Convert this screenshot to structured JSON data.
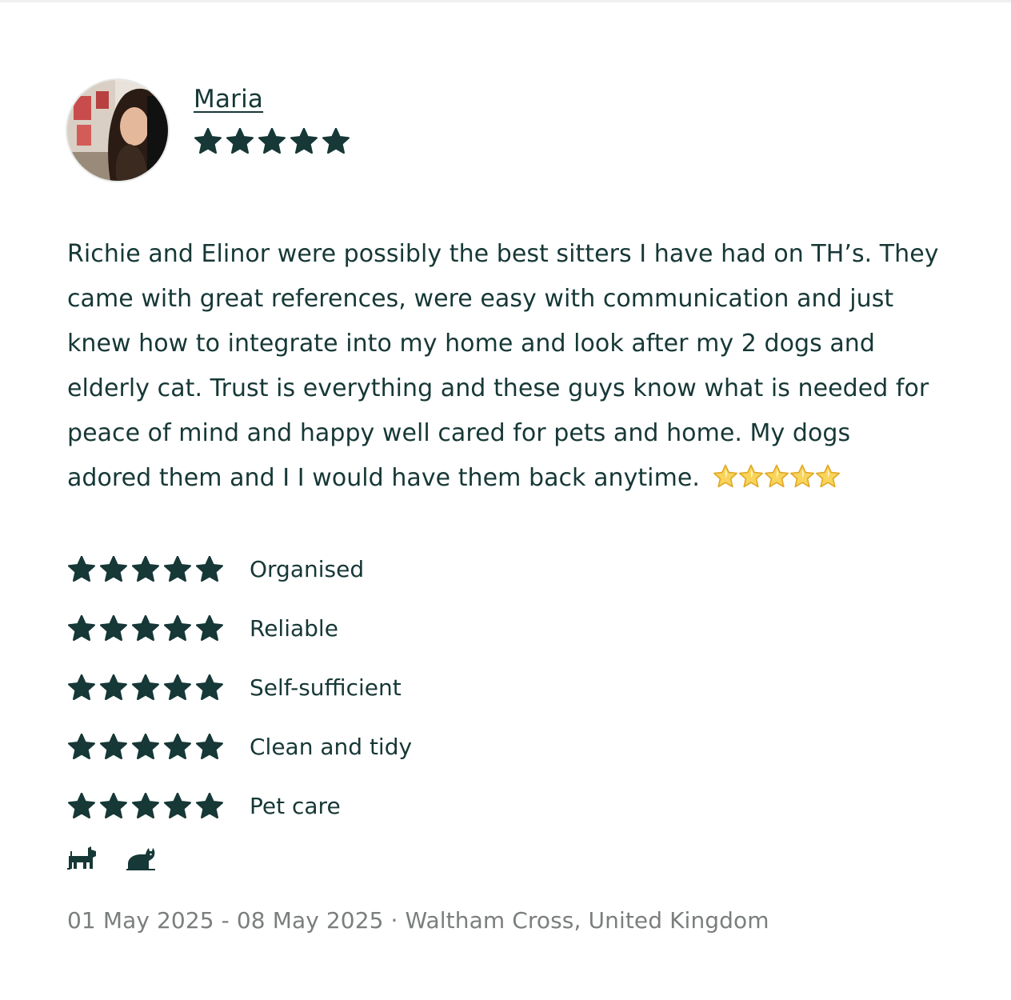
{
  "reviewer": {
    "name": "Maria",
    "overall_rating": 5,
    "avatar_icon": "reviewer-photo"
  },
  "review": {
    "text": "Richie and Elinor were possibly the best sitters I have had on TH’s. They came with great references, were easy with communication and just knew how to integrate into my home and look after my 2 dogs and elderly cat. Trust is everything and these guys know what is needed for peace of mind and happy well cared for pets and home. My dogs adored them and I I would have them back anytime.",
    "emoji_stars": 5
  },
  "ratings": [
    {
      "label": "Organised",
      "stars": 5
    },
    {
      "label": "Reliable",
      "stars": 5
    },
    {
      "label": "Self-sufficient",
      "stars": 5
    },
    {
      "label": "Clean and tidy",
      "stars": 5
    },
    {
      "label": "Pet care",
      "stars": 5
    }
  ],
  "pets": [
    "dog-icon",
    "cat-icon"
  ],
  "footer": {
    "text": "01 May 2025 - 08 May 2025 · Waltham Cross, United Kingdom"
  },
  "colors": {
    "primary": "#163836",
    "muted": "#7b7e7e",
    "emoji_star": "#f7c948"
  }
}
